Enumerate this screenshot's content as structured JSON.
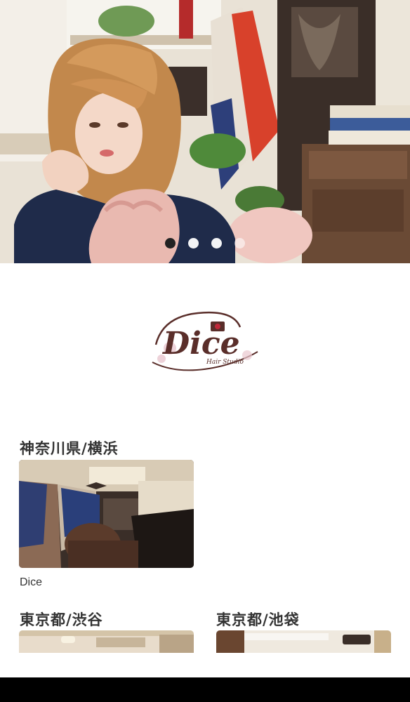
{
  "hero": {
    "slide_count": 4,
    "active_index": 0
  },
  "logo": {
    "text": "Dice",
    "tagline": "Hair Studio",
    "primary_color": "#5a2e2a",
    "accent_color": "#c0283a"
  },
  "areas": [
    {
      "title": "神奈川県/横浜",
      "salons": [
        {
          "name": "Dice"
        }
      ]
    },
    {
      "title": "東京都/渋谷",
      "salons": []
    },
    {
      "title": "東京都/池袋",
      "salons": []
    }
  ]
}
